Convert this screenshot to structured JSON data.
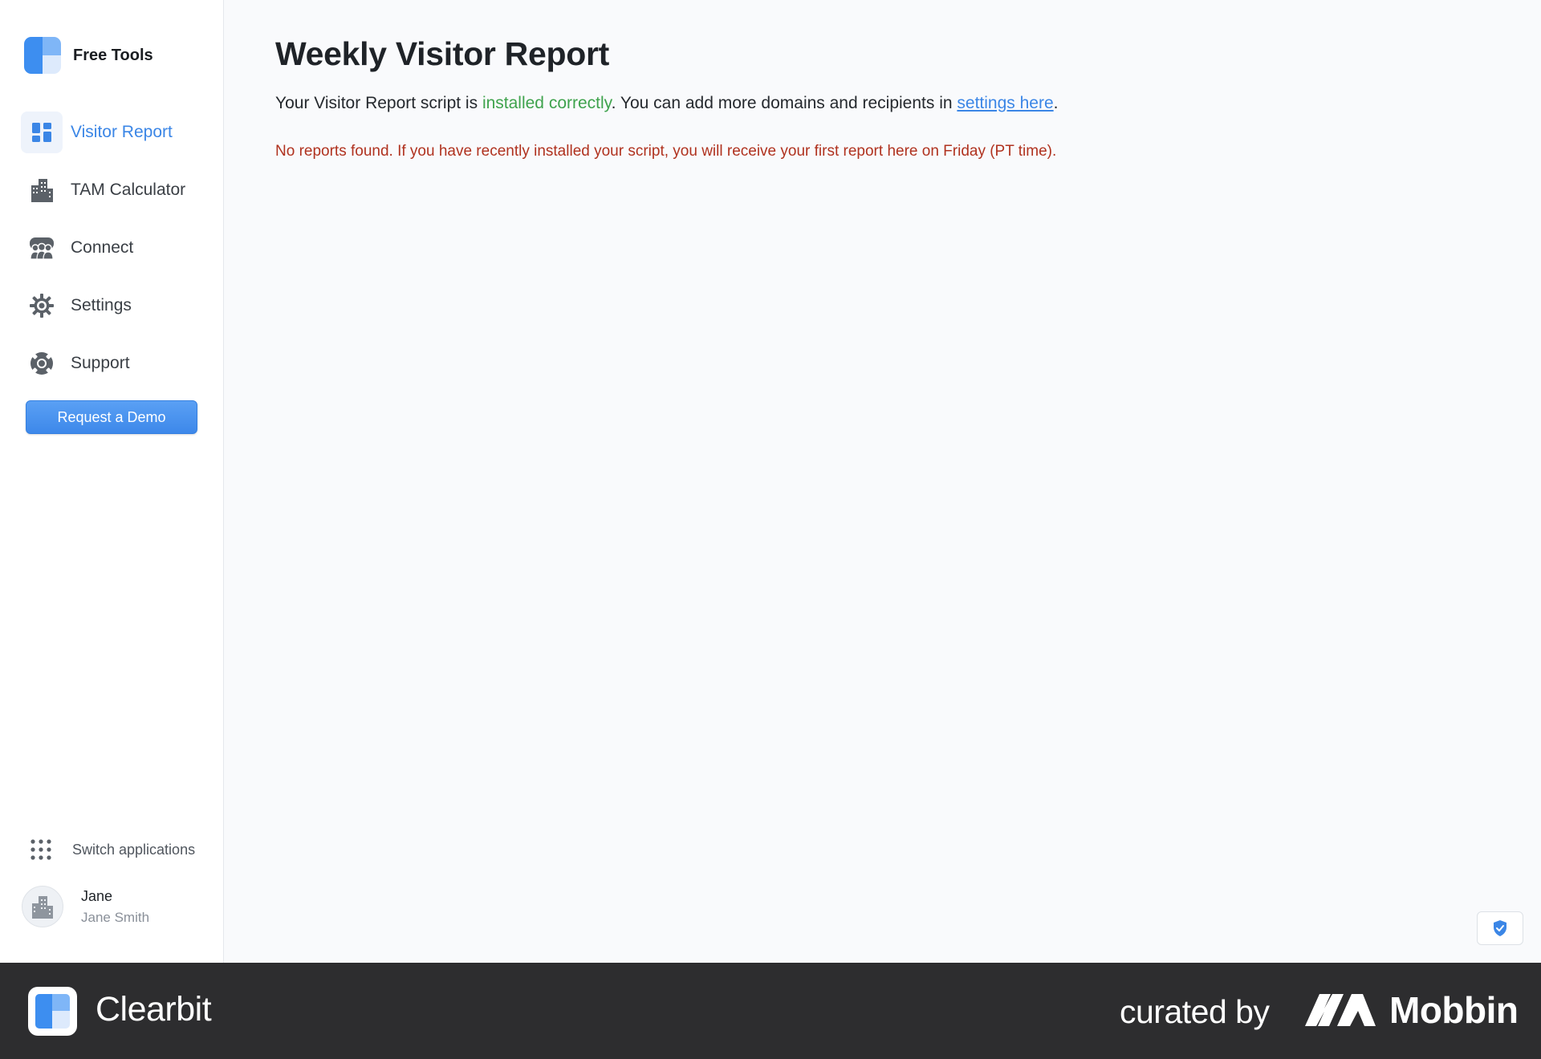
{
  "sidebar": {
    "brand": "Free Tools",
    "nav": [
      {
        "label": "Visitor Report",
        "icon": "dashboard-icon",
        "active": true
      },
      {
        "label": "TAM Calculator",
        "icon": "buildings-icon",
        "active": false
      },
      {
        "label": "Connect",
        "icon": "people-icon",
        "active": false
      },
      {
        "label": "Settings",
        "icon": "gear-icon",
        "active": false
      },
      {
        "label": "Support",
        "icon": "lifebuoy-icon",
        "active": false
      }
    ],
    "demo_button": "Request a Demo",
    "switch_apps": "Switch applications",
    "user": {
      "first_name": "Jane",
      "full_name": "Jane Smith"
    }
  },
  "main": {
    "title": "Weekly Visitor Report",
    "status": {
      "prefix": "Your Visitor Report script is ",
      "highlight": "installed correctly",
      "middle": ". You can add more domains and recipients in ",
      "link": "settings here",
      "suffix": "."
    },
    "notice": "No reports found. If you have recently installed your script, you will receive your first report here on Friday (PT time)."
  },
  "footer": {
    "brand": "Clearbit",
    "curated_by": "curated by",
    "mobbin": "Mobbin"
  },
  "colors": {
    "accent": "#3b86e6",
    "success": "#3fa34d",
    "error": "#b0321f",
    "footer_bg": "#2d2d2f"
  }
}
